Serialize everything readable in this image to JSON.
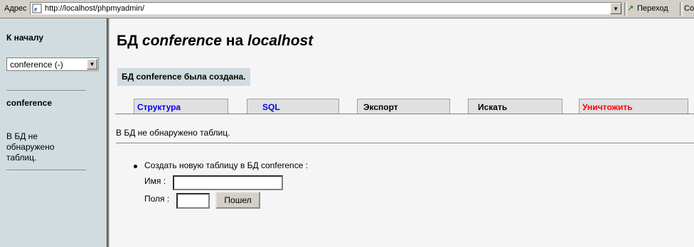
{
  "browser": {
    "address_label": "Адрес",
    "url": "http://localhost/phpmyadmin/",
    "go_label": "Переход",
    "links_label": "Со"
  },
  "sidebar": {
    "home_link": "К началу",
    "db_select_value": "conference (-)",
    "db_name": "conference",
    "no_tables_text": "В БД не обнаружено таблиц."
  },
  "main": {
    "title_prefix": "БД",
    "title_db": "conference",
    "title_middle": "на",
    "title_host": "localhost",
    "notice": "БД conference была создана.",
    "tabs": [
      {
        "label": "Структура"
      },
      {
        "label": "SQL"
      },
      {
        "label": "Экспорт"
      },
      {
        "label": "Искать"
      },
      {
        "label": "Уничтожить"
      }
    ],
    "status": "В БД не обнаружено таблиц.",
    "create_table": {
      "label": "Создать новую таблицу в БД conference :",
      "name_label": "Имя :",
      "name_value": "",
      "fields_label": "Поля :",
      "fields_value": "",
      "submit_label": "Пошел"
    }
  },
  "colors": {
    "sidebar_bg": "#d0dce0",
    "tab_link": "#0000ee",
    "tab_danger": "#ff0000"
  }
}
